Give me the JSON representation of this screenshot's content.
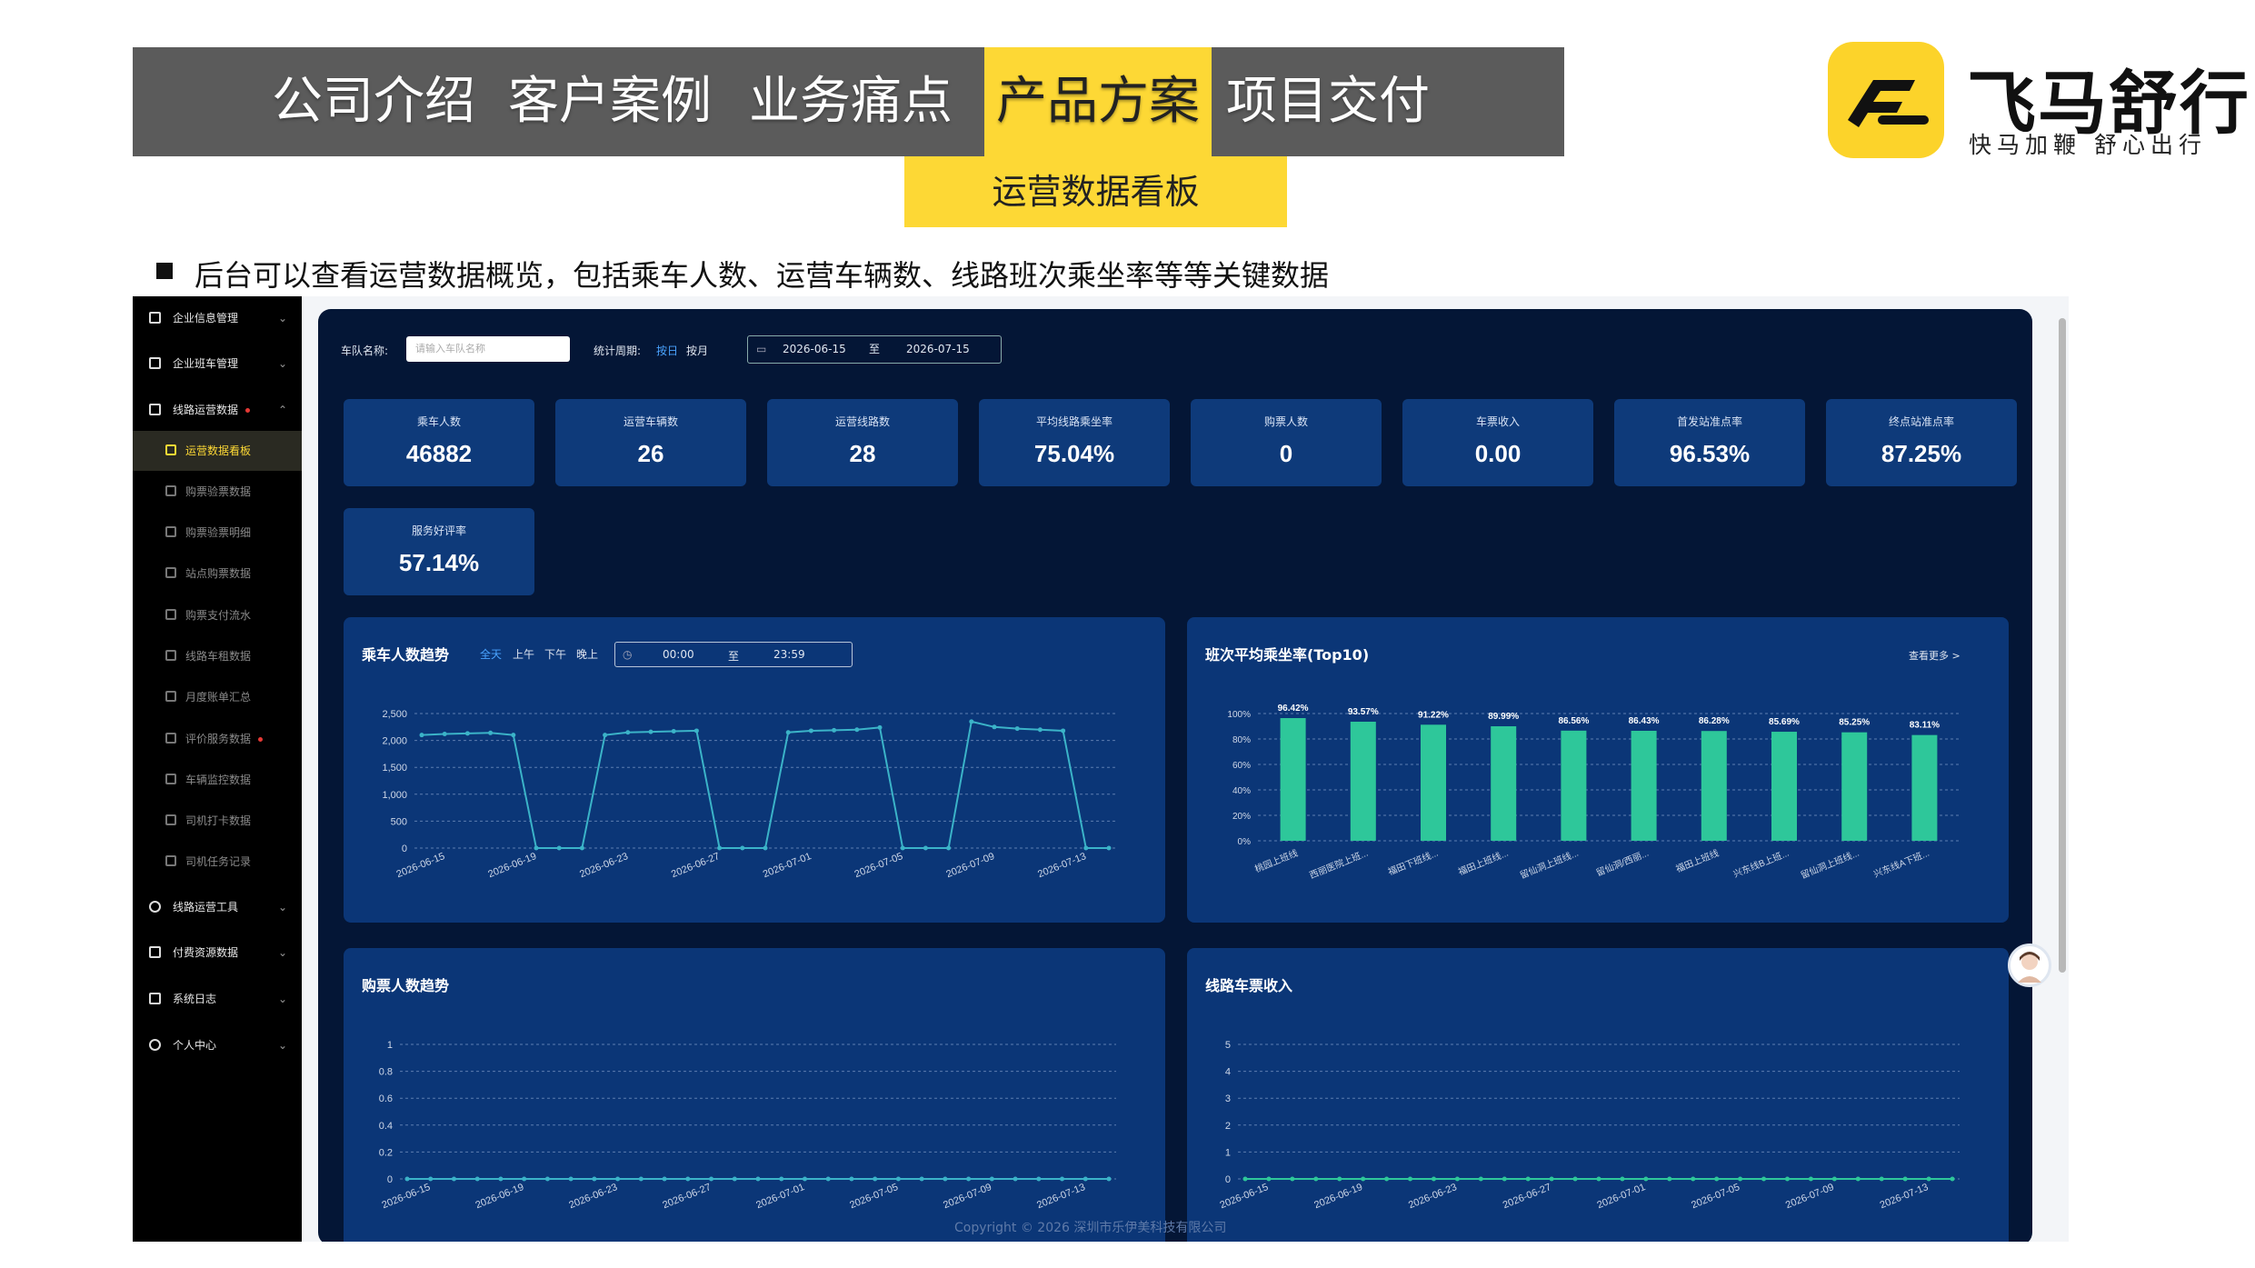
{
  "slide": {
    "nav_tabs": [
      "公司介绍",
      "客户案例",
      "业务痛点",
      "产品方案",
      "项目交付"
    ],
    "active_tab": "产品方案",
    "sub_tab": "运营数据看板",
    "bullet_text": "后台可以查看运营数据概览，包括乘车人数、运营车辆数、线路班次乘坐率等等关键数据",
    "logo": {
      "name": "飞马舒行",
      "slogan": "快马加鞭  舒心出行",
      "brand_color": "#fcd32a"
    }
  },
  "sidebar": {
    "items": [
      {
        "label": "企业信息管理"
      },
      {
        "label": "企业班车管理"
      },
      {
        "label": "线路运营数据"
      }
    ],
    "sub_items": [
      {
        "label": "运营数据看板",
        "active": true
      },
      {
        "label": "购票验票数据"
      },
      {
        "label": "购票验票明细"
      },
      {
        "label": "站点购票数据"
      },
      {
        "label": "购票支付流水"
      },
      {
        "label": "线路车租数据"
      },
      {
        "label": "月度账单汇总"
      },
      {
        "label": "评价服务数据"
      },
      {
        "label": "车辆监控数据"
      },
      {
        "label": "司机打卡数据"
      },
      {
        "label": "司机任务记录"
      }
    ],
    "bottom_items": [
      {
        "label": "线路运营工具"
      },
      {
        "label": "付费资源数据"
      },
      {
        "label": "系统日志"
      },
      {
        "label": "个人中心"
      }
    ]
  },
  "filters": {
    "team_label": "车队名称:",
    "team_placeholder": "请输入车队名称",
    "period_label": "统计周期:",
    "by_day": "按日",
    "by_month": "按月",
    "date_start": "2026-06-15",
    "date_sep": "至",
    "date_end": "2026-07-15"
  },
  "kpis": [
    {
      "title": "乘车人数",
      "value": "46882"
    },
    {
      "title": "运营车辆数",
      "value": "26"
    },
    {
      "title": "运营线路数",
      "value": "28"
    },
    {
      "title": "平均线路乘坐率",
      "value": "75.04%"
    },
    {
      "title": "购票人数",
      "value": "0"
    },
    {
      "title": "车票收入",
      "value": "0.00"
    },
    {
      "title": "首发站准点率",
      "value": "96.53%"
    },
    {
      "title": "终点站准点率",
      "value": "87.25%"
    },
    {
      "title": "服务好评率",
      "value": "57.14%"
    }
  ],
  "panels": {
    "ride_trend": {
      "title": "乘车人数趋势",
      "ranges": [
        "全天",
        "上午",
        "下午",
        "晚上"
      ],
      "time_start": "00:00",
      "time_sep": "至",
      "time_end": "23:59"
    },
    "occupancy_top10": {
      "title": "班次平均乘坐率(Top10)",
      "more": "查看更多 >"
    },
    "ticket_trend": {
      "title": "购票人数趋势"
    },
    "revenue": {
      "title": "线路车票收入"
    }
  },
  "footer": "Copyright © 2026 深圳市乐伊美科技有限公司",
  "chart_data": [
    {
      "type": "line",
      "title": "乘车人数趋势",
      "x_ticks": [
        "2026-06-15",
        "2026-06-19",
        "2026-06-23",
        "2026-06-27",
        "2026-07-01",
        "2026-07-05",
        "2026-07-09",
        "2026-07-13"
      ],
      "ylim": [
        0,
        2500
      ],
      "y_ticks": [
        "2,500",
        "2,000",
        "1,500",
        "1,000",
        "500",
        "0"
      ],
      "x": [
        "06-15",
        "06-16",
        "06-17",
        "06-18",
        "06-19",
        "06-20",
        "06-21",
        "06-22",
        "06-23",
        "06-24",
        "06-25",
        "06-26",
        "06-27",
        "06-28",
        "06-29",
        "06-30",
        "07-01",
        "07-02",
        "07-03",
        "07-04",
        "07-05",
        "07-06",
        "07-07",
        "07-08",
        "07-09",
        "07-10",
        "07-11",
        "07-12",
        "07-13",
        "07-14",
        "07-15"
      ],
      "values": [
        2100,
        2120,
        2130,
        2140,
        2100,
        0,
        0,
        0,
        2100,
        2150,
        2160,
        2170,
        2180,
        0,
        0,
        0,
        2150,
        2180,
        2190,
        2200,
        2240,
        0,
        0,
        0,
        2350,
        2250,
        2220,
        2200,
        2180,
        0,
        0
      ],
      "color": "#3bb3c8",
      "grid": true
    },
    {
      "type": "bar",
      "title": "班次平均乘坐率(Top10)",
      "categories": [
        "桃园上班线",
        "西丽医院上班...",
        "福田下班线...",
        "福田上班线...",
        "留仙洞上班线...",
        "留仙洞/西丽...",
        "福田上班线",
        "兴东线B上班...",
        "留仙洞上班线...",
        "兴东线A下班..."
      ],
      "values": [
        96.42,
        93.57,
        91.22,
        89.99,
        86.56,
        86.43,
        86.28,
        85.69,
        85.25,
        83.11
      ],
      "labels": [
        "96.42%",
        "93.57%",
        "91.22%",
        "89.99%",
        "86.56%",
        "86.43%",
        "86.28%",
        "85.69%",
        "85.25%",
        "83.11%"
      ],
      "ylim": [
        0,
        100
      ],
      "y_ticks": [
        "100%",
        "80%",
        "60%",
        "40%",
        "20%",
        "0%"
      ],
      "color": "#2ec79a",
      "grid": true
    },
    {
      "type": "line",
      "title": "购票人数趋势",
      "x_ticks": [
        "2026-06-15",
        "2026-06-19",
        "2026-06-23",
        "2026-06-27",
        "2026-07-01",
        "2026-07-05",
        "2026-07-09",
        "2026-07-13"
      ],
      "ylim": [
        0,
        1
      ],
      "y_ticks": [
        "1",
        "0.8",
        "0.6",
        "0.4",
        "0.2",
        "0"
      ],
      "values": [
        0,
        0,
        0,
        0,
        0,
        0,
        0,
        0,
        0,
        0,
        0,
        0,
        0,
        0,
        0,
        0,
        0,
        0,
        0,
        0,
        0,
        0,
        0,
        0,
        0,
        0,
        0,
        0,
        0,
        0,
        0
      ],
      "color": "#3bb3c8",
      "grid": true
    },
    {
      "type": "line",
      "title": "线路车票收入",
      "x_ticks": [
        "2026-06-15",
        "2026-06-19",
        "2026-06-23",
        "2026-06-27",
        "2026-07-01",
        "2026-07-05",
        "2026-07-09",
        "2026-07-13"
      ],
      "ylim": [
        0,
        5
      ],
      "y_ticks": [
        "5",
        "4",
        "3",
        "2",
        "1",
        "0"
      ],
      "values": [
        0,
        0,
        0,
        0,
        0,
        0,
        0,
        0,
        0,
        0,
        0,
        0,
        0,
        0,
        0,
        0,
        0,
        0,
        0,
        0,
        0,
        0,
        0,
        0,
        0,
        0,
        0,
        0,
        0,
        0,
        0
      ],
      "color": "#2ec79a",
      "grid": true
    }
  ]
}
